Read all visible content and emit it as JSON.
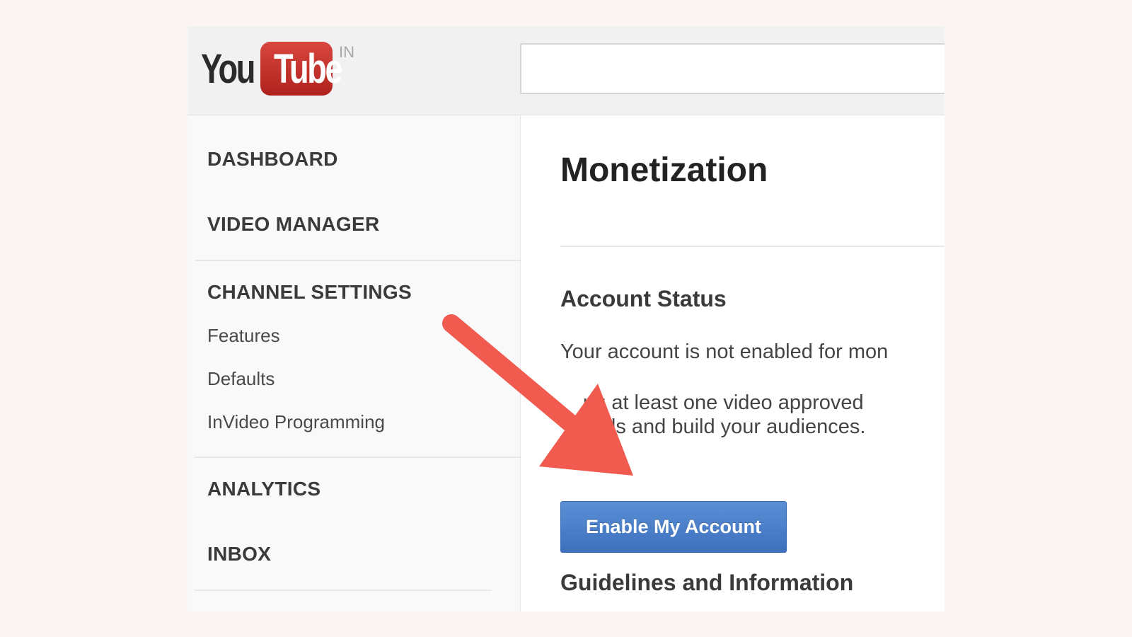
{
  "header": {
    "logo_you": "You",
    "logo_tube": "Tube",
    "logo_region": "IN",
    "search_value": ""
  },
  "sidebar": {
    "dashboard": "DASHBOARD",
    "video_manager": "VIDEO MANAGER",
    "channel_settings": "CHANNEL SETTINGS",
    "channel_settings_items": [
      "Features",
      "Defaults",
      "InVideo Programming"
    ],
    "analytics": "ANALYTICS",
    "inbox": "INBOX"
  },
  "main": {
    "title": "Monetization",
    "account_status_heading": "Account Status",
    "status_line": "Your account is not enabled for mon",
    "info_line_1": "ng at least one video approved",
    "info_line_2": "skills and build your audiences.",
    "enable_button_label": "Enable My Account",
    "guidelines_heading": "Guidelines and Information"
  },
  "colors": {
    "page_background": "#fbf5f4",
    "logo_red": "#c4302b",
    "button_blue": "#4a7fca",
    "arrow_red": "#f05a4f"
  }
}
